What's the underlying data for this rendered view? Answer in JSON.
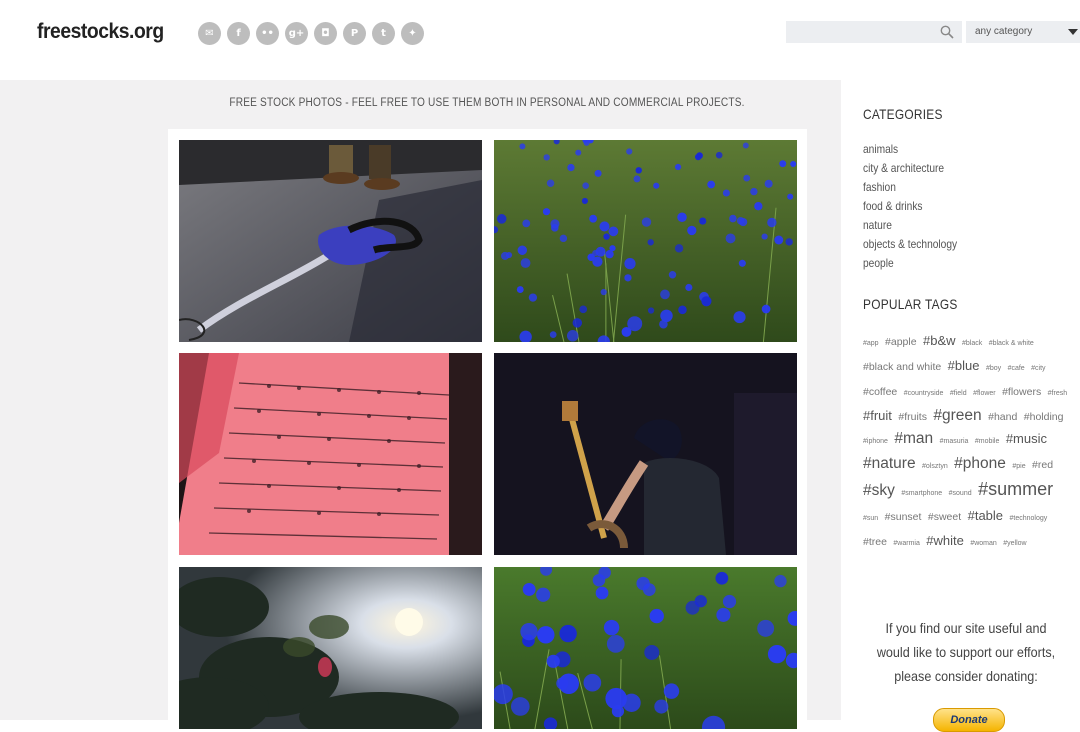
{
  "header": {
    "logo": "freestocks.org",
    "social_icons": [
      {
        "name": "email-icon",
        "glyph": "✉"
      },
      {
        "name": "facebook-icon",
        "glyph": "f"
      },
      {
        "name": "flickr-icon",
        "glyph": "••"
      },
      {
        "name": "google-plus-icon",
        "glyph": "g+"
      },
      {
        "name": "instagram-icon",
        "glyph": "◘"
      },
      {
        "name": "pinterest-icon",
        "glyph": "P"
      },
      {
        "name": "tumblr-icon",
        "glyph": "t"
      },
      {
        "name": "twitter-icon",
        "glyph": "✦"
      }
    ],
    "search": {
      "placeholder": "",
      "value": ""
    },
    "category_select": {
      "selected": "any category"
    }
  },
  "main": {
    "tagline": "FREE STOCK PHOTOS - FEEL FREE TO USE THEM BOTH IN PERSONAL AND COMMERCIAL PROJECTS."
  },
  "sidebar": {
    "categories_heading": "CATEGORIES",
    "categories": [
      "animals",
      "city & architecture",
      "fashion",
      "food & drinks",
      "nature",
      "objects & technology",
      "people"
    ],
    "tags_heading": "POPULAR TAGS",
    "tags": [
      {
        "label": "app",
        "size": 1
      },
      {
        "label": "apple",
        "size": 2
      },
      {
        "label": "b&w",
        "size": 3
      },
      {
        "label": "black",
        "size": 1
      },
      {
        "label": "black & white",
        "size": 1
      },
      {
        "label": "black and white",
        "size": 2
      },
      {
        "label": "blue",
        "size": 3
      },
      {
        "label": "boy",
        "size": 1
      },
      {
        "label": "cafe",
        "size": 1
      },
      {
        "label": "city",
        "size": 1
      },
      {
        "label": "coffee",
        "size": 2
      },
      {
        "label": "countryside",
        "size": 1
      },
      {
        "label": "field",
        "size": 1
      },
      {
        "label": "flower",
        "size": 1
      },
      {
        "label": "flowers",
        "size": 2
      },
      {
        "label": "fresh",
        "size": 1
      },
      {
        "label": "fruit",
        "size": 3
      },
      {
        "label": "fruits",
        "size": 2
      },
      {
        "label": "green",
        "size": 4
      },
      {
        "label": "hand",
        "size": 2
      },
      {
        "label": "holding",
        "size": 2
      },
      {
        "label": "iphone",
        "size": 1
      },
      {
        "label": "man",
        "size": 4
      },
      {
        "label": "masuria",
        "size": 1
      },
      {
        "label": "mobile",
        "size": 1
      },
      {
        "label": "music",
        "size": 3
      },
      {
        "label": "nature",
        "size": 4
      },
      {
        "label": "olsztyn",
        "size": 1
      },
      {
        "label": "phone",
        "size": 4
      },
      {
        "label": "pie",
        "size": 1
      },
      {
        "label": "red",
        "size": 2
      },
      {
        "label": "sky",
        "size": 4
      },
      {
        "label": "smartphone",
        "size": 1
      },
      {
        "label": "sound",
        "size": 1
      },
      {
        "label": "summer",
        "size": 5
      },
      {
        "label": "sun",
        "size": 1
      },
      {
        "label": "sunset",
        "size": 2
      },
      {
        "label": "sweet",
        "size": 2
      },
      {
        "label": "table",
        "size": 3
      },
      {
        "label": "technology",
        "size": 1
      },
      {
        "label": "tree",
        "size": 2
      },
      {
        "label": "warmia",
        "size": 1
      },
      {
        "label": "white",
        "size": 3
      },
      {
        "label": "woman",
        "size": 1
      },
      {
        "label": "yellow",
        "size": 1
      }
    ],
    "donate_text": "If you find our site useful and would like to support our efforts, please consider donating:",
    "donate_button": "Donate"
  },
  "colors": {
    "main_bg": "#f2f1f2",
    "social_icon_bg": "#bdbdbd",
    "flower_blue": "#2a3cf0"
  }
}
